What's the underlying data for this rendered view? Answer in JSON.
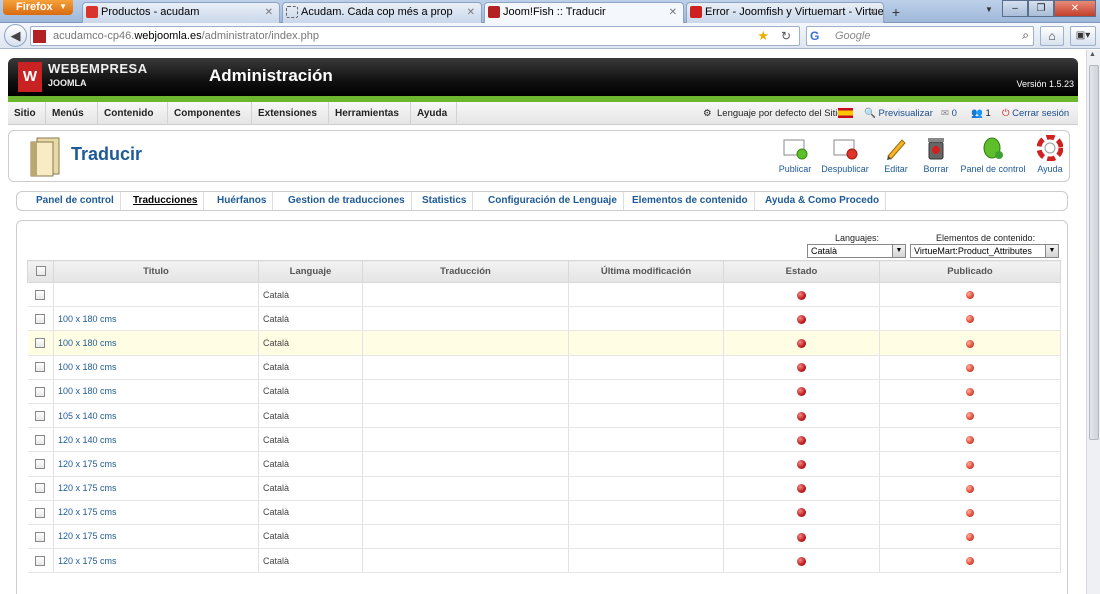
{
  "browser": {
    "app_button": "Firefox",
    "tabs": [
      {
        "title": "Productos - acudam"
      },
      {
        "title": "Acudam. Cada cop més a prop"
      },
      {
        "title": "Joom!Fish :: Traducir"
      },
      {
        "title": "Error - Joomfish y Virtuemart - Virtue..."
      }
    ],
    "url_prefix": "acudamco-cp46.",
    "url_domain": "webjoomla.es",
    "url_path": "/administrator/index.php",
    "search_placeholder": "Google"
  },
  "header": {
    "logo_line1": "WEBEMPRESA",
    "logo_line2": "JOOMLA",
    "title": "Administración",
    "version": "Versión 1.5.23"
  },
  "menu": {
    "items": [
      "Sitio",
      "Menús",
      "Contenido",
      "Componentes",
      "Extensiones",
      "Herramientas",
      "Ayuda"
    ],
    "default_language": "Lenguaje por defecto del Sitio:",
    "preview": "Previsualizar",
    "messages_count": "0",
    "users_count": "1",
    "logout": "Cerrar sesión"
  },
  "toolbar": {
    "page_title": "Traducir",
    "buttons": [
      "Publicar",
      "Despublicar",
      "Editar",
      "Borrar",
      "Panel de control",
      "Ayuda"
    ]
  },
  "subnav": {
    "items": [
      "Panel de control",
      "Traducciones",
      "Huérfanos",
      "Gestion de traducciones",
      "Statistics",
      "Configuración de Lenguaje",
      "Elementos de contenido",
      "Ayuda & Como Procedo"
    ],
    "active": "Traducciones"
  },
  "filters": {
    "languages_label": "Languajes:",
    "languages_value": "Català",
    "elements_label": "Elementos de contenido:",
    "elements_value": "VirtueMart:Product_Attributes"
  },
  "table": {
    "headers": [
      "Titulo",
      "Languaje",
      "Traducción",
      "Última modificación",
      "Estado",
      "Publicado"
    ],
    "rows": [
      {
        "title": "",
        "language": "Català"
      },
      {
        "title": "100 x 180 cms",
        "language": "Català"
      },
      {
        "title": "100 x 180 cms",
        "language": "Català"
      },
      {
        "title": "100 x 180 cms",
        "language": "Català"
      },
      {
        "title": "100 x 180 cms",
        "language": "Català"
      },
      {
        "title": "105 x 140 cms",
        "language": "Català"
      },
      {
        "title": "120 x 140 cms",
        "language": "Català"
      },
      {
        "title": "120 x 175 cms",
        "language": "Català"
      },
      {
        "title": "120 x 175 cms",
        "language": "Català"
      },
      {
        "title": "120 x 175 cms",
        "language": "Català"
      },
      {
        "title": "120 x 175 cms",
        "language": "Català"
      },
      {
        "title": "120 x 175 cms",
        "language": "Català"
      }
    ],
    "highlighted_row": 2
  },
  "colors": {
    "accent_green": "#6cb72e",
    "link_blue": "#1e5a97",
    "status_red": "#c11a1a",
    "row_highlight": "#fffee4"
  }
}
